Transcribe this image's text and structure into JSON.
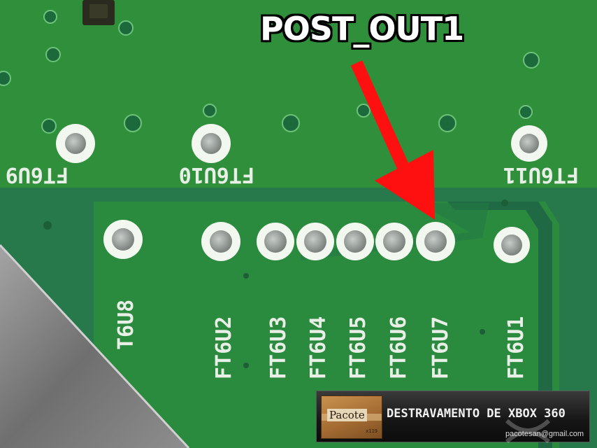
{
  "photo": {
    "subject": "xbox-360-pcb-post-out-test-points",
    "colors": {
      "board": "#2f8f3a",
      "copper_pour": "#1f6e45",
      "pad_ring": "#f2f7ef",
      "pad_metal": "#8d948f",
      "arrow": "#ff1010",
      "shield_metal": "#8b8b8b"
    }
  },
  "silkscreen": {
    "top_row": [
      "FT6U9",
      "FT6U10",
      "FT6U11"
    ],
    "vertical": [
      "T6U8",
      "FT6U2",
      "FT6U3",
      "FT6U4",
      "FT6U5",
      "FT6U6",
      "FT6U7",
      "FT6U1"
    ]
  },
  "callout": {
    "label": "POST_OUT1",
    "icon": "arrow-down-right-icon"
  },
  "watermark": {
    "brand": "Pacote",
    "small_text": "x119",
    "title": "DESTRAVAMENTO DE XBOX 360",
    "email": "pacotesan@gmail.com",
    "icon": "xbox-logo-icon"
  }
}
